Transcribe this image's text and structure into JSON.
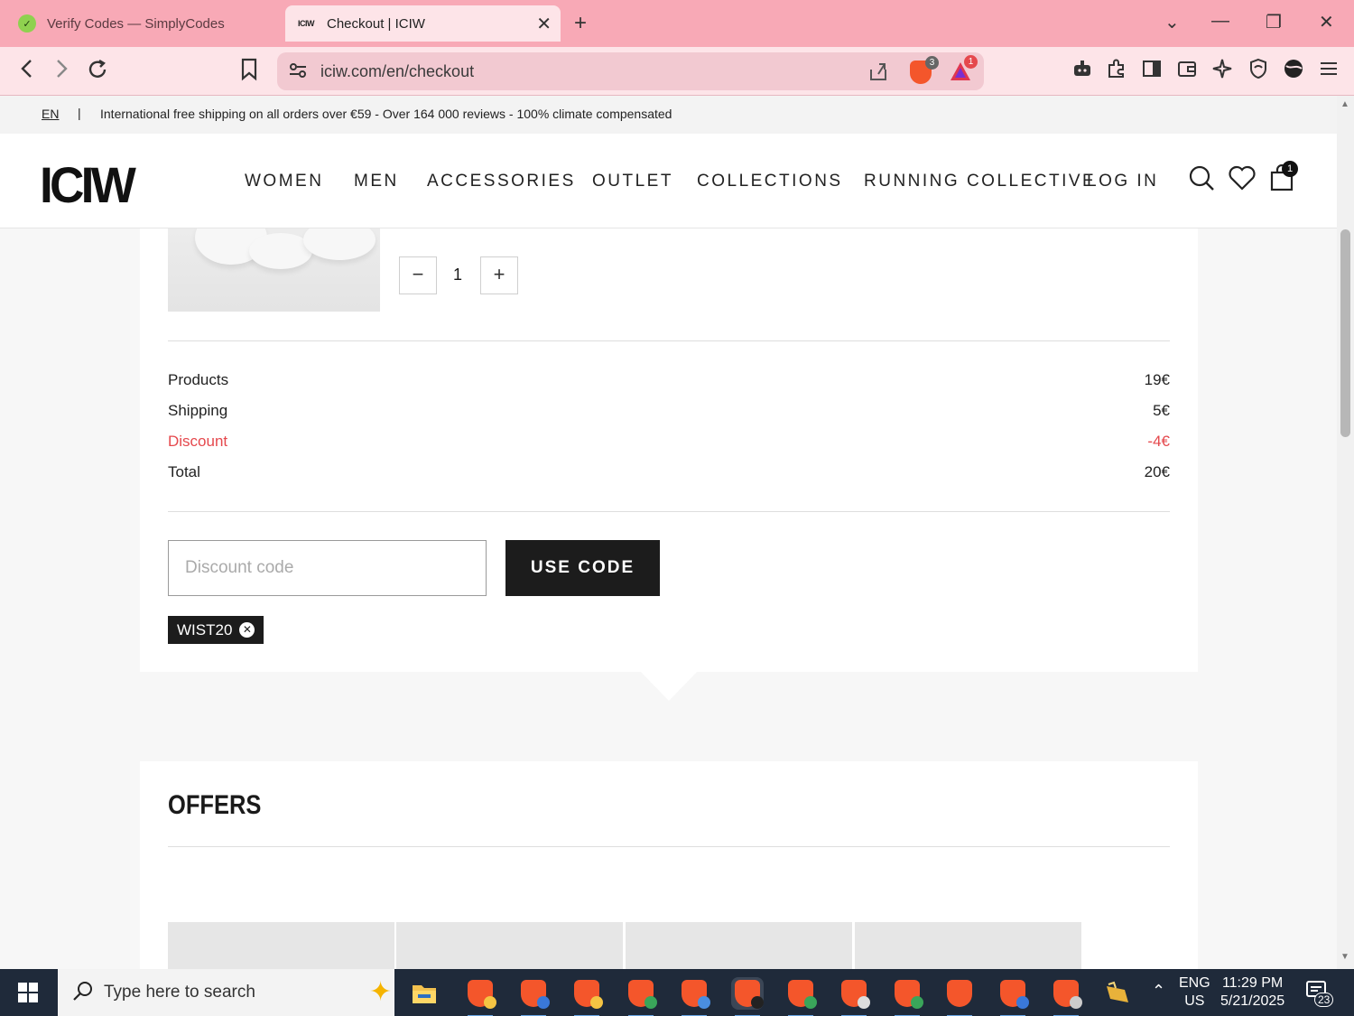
{
  "browser": {
    "tabs": [
      {
        "title": "Verify Codes — SimplyCodes",
        "active": false
      },
      {
        "title": "Checkout | ICIW",
        "active": true
      }
    ],
    "tab_favicon_iciw": "ICIW",
    "url": "iciw.com/en/checkout",
    "brave_shield_count": "3",
    "rewards_count": "1"
  },
  "announcement": {
    "lang": "EN",
    "separator": "|",
    "message": "International free shipping on all orders over €59 - Over 164 000 reviews - 100% climate compensated"
  },
  "header": {
    "logo": "ICIW",
    "nav": [
      "WOMEN",
      "MEN",
      "ACCESSORIES",
      "OUTLET",
      "COLLECTIONS",
      "RUNNING COLLECTIVE"
    ],
    "login": "LOG IN",
    "cart_count": "1"
  },
  "cart": {
    "quantity": "1",
    "summary": [
      {
        "label": "Products",
        "value": "19€"
      },
      {
        "label": "Shipping",
        "value": "5€"
      },
      {
        "label": "Discount",
        "value": "-4€"
      },
      {
        "label": "Total",
        "value": "20€"
      }
    ],
    "discount_placeholder": "Discount code",
    "use_code_label": "USE CODE",
    "applied_code": "WIST20"
  },
  "offers": {
    "title": "OFFERS"
  },
  "taskbar": {
    "search_placeholder": "Type here to search",
    "lang_top": "ENG",
    "lang_bottom": "US",
    "time": "11:29 PM",
    "date": "5/21/2025",
    "notifications": "23"
  },
  "colors": {
    "tabbar": "#f8a9b6",
    "toolbar": "#fde4e8",
    "discount_red": "#e5484d",
    "button_dark": "#1c1c1c"
  }
}
